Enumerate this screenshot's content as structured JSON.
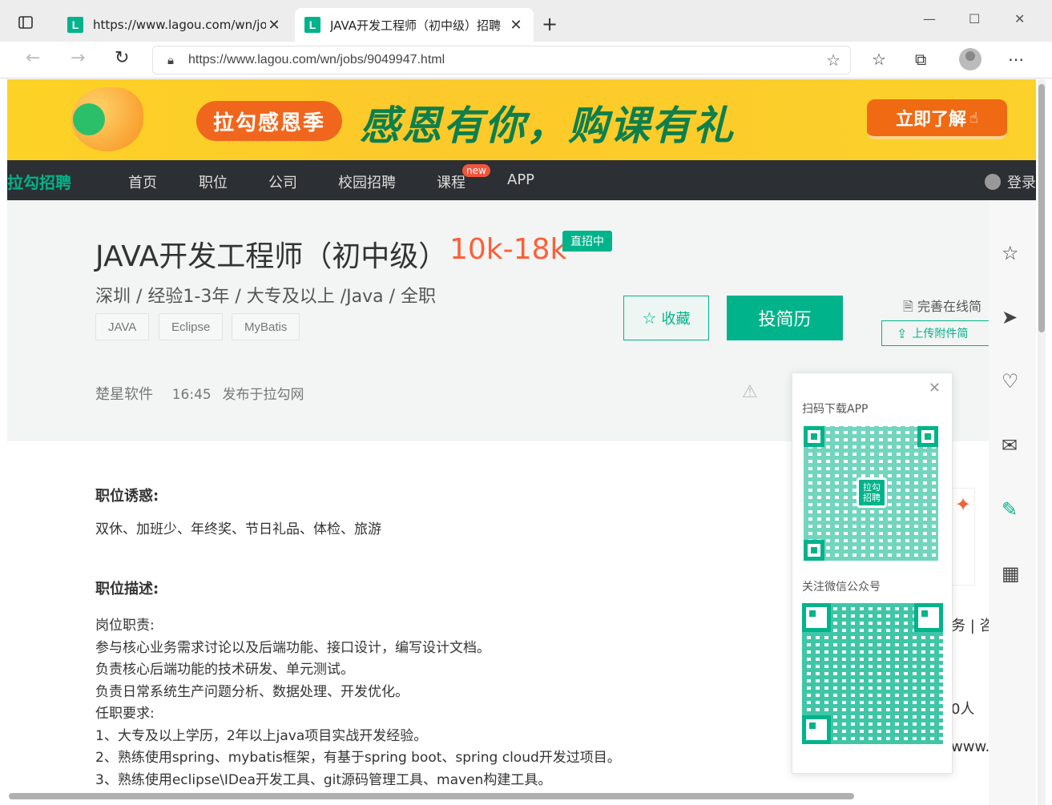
{
  "browser": {
    "tabs": [
      {
        "title": "https://www.lagou.com/wn/jobs?",
        "active": false
      },
      {
        "title": "JAVA开发工程师（初中级）招聘",
        "active": true
      }
    ],
    "favicon_letter": "L",
    "address": "https://www.lagou.com/wn/jobs/9049947.html"
  },
  "banner": {
    "pill": "拉勾感恩季",
    "slogan": "感恩有你，购课有礼",
    "cta": "立即了解"
  },
  "nav": {
    "logo": "拉勾招聘",
    "items": [
      "首页",
      "职位",
      "公司",
      "校园招聘",
      "课程",
      "APP"
    ],
    "new_badge": "new",
    "login": "登录"
  },
  "job": {
    "title": "JAVA开发工程师（初中级）",
    "salary": "10k-18k",
    "badge": "直招中",
    "meta": "深圳 / 经验1-3年 / 大专及以上 /Java / 全职",
    "tags": [
      "JAVA",
      "Eclipse",
      "MyBatis"
    ],
    "fav_label": "收藏",
    "apply_label": "投简历",
    "resume_link": "完善在线简",
    "upload_label": "上传附件简",
    "company": "楚星软件",
    "time": "16:45",
    "published": "发布于拉勾网"
  },
  "content": {
    "perk_title": "职位诱惑:",
    "perks": "双休、加班少、年终奖、节日礼品、体检、旅游",
    "desc_title": "职位描述:",
    "desc_lines": [
      "岗位职责:",
      "参与核心业务需求讨论以及后端功能、接口设计，编写设计文档。",
      "负责核心后端功能的技术研发、单元测试。",
      "负责日常系统生产问题分析、数据处理、开发优化。",
      "任职要求:",
      "1、大专及以上学历，2年以上java项目实战开发经验。",
      "2、熟练使用spring、mybatis框架，有基于spring boot、spring cloud开发过项目。",
      "3、熟练使用eclipse\\IDea开发工具、git源码管理工具、maven构建工具。"
    ]
  },
  "qr_popup": {
    "app_label": "扫码下载APP",
    "wechat_label": "关注微信公众号",
    "logo_text": "拉勾招聘"
  },
  "peek": {
    "service": "务 | 咨",
    "people": "0人",
    "www": "www.c"
  },
  "colors": {
    "brand": "#00b38a",
    "salary": "#fd5f39",
    "nav_bg": "#2c2f33",
    "banner_bg": "#fcc92a"
  }
}
